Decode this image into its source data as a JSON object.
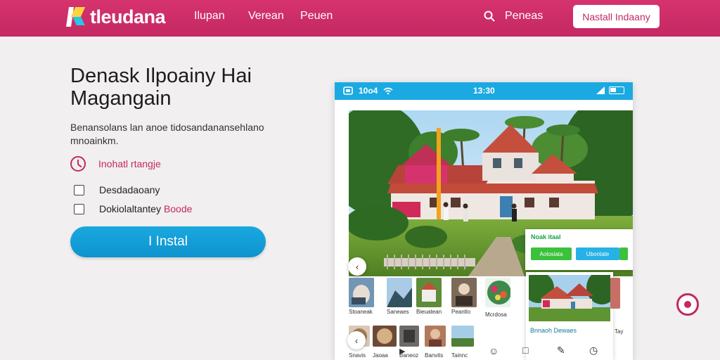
{
  "header": {
    "logo_text": "tleudana",
    "nav": [
      "Ilupan",
      "Verean",
      "Peuen"
    ],
    "search_label": "Peneas",
    "install_button": "Nastall Indaany"
  },
  "hero": {
    "title": "Denask Ilpoainy  Hai Magangain",
    "description": "Benansolans lan anoe tidosandanansehlano mnoainkm.",
    "feature_main": "Inohatl rtangje",
    "check_items": [
      "Desdadaoany",
      "Dokiolaltantey"
    ],
    "check_accent": "Boode",
    "install_button": "I Instal"
  },
  "phone": {
    "status_left": "10o4",
    "status_time": "13:30",
    "overlay_title": "Noak itaal",
    "overlay_buttons": [
      "Aolosiata",
      "Ubontate"
    ],
    "thumb_labels": [
      "Stoaneak",
      "Saneaes",
      "Bieuatean",
      "Peantlo",
      "Mcrdosa",
      "Snavis",
      "Jaoaa",
      "Baneoz",
      "Banvits",
      "Tainnc"
    ],
    "feature_card_caption": "Bnnaoh Dewaes",
    "side_label": "Tay"
  },
  "colors": {
    "brand": "#c42862",
    "accent_blue": "#1ba9e1",
    "accent_green": "#3bc13b"
  }
}
